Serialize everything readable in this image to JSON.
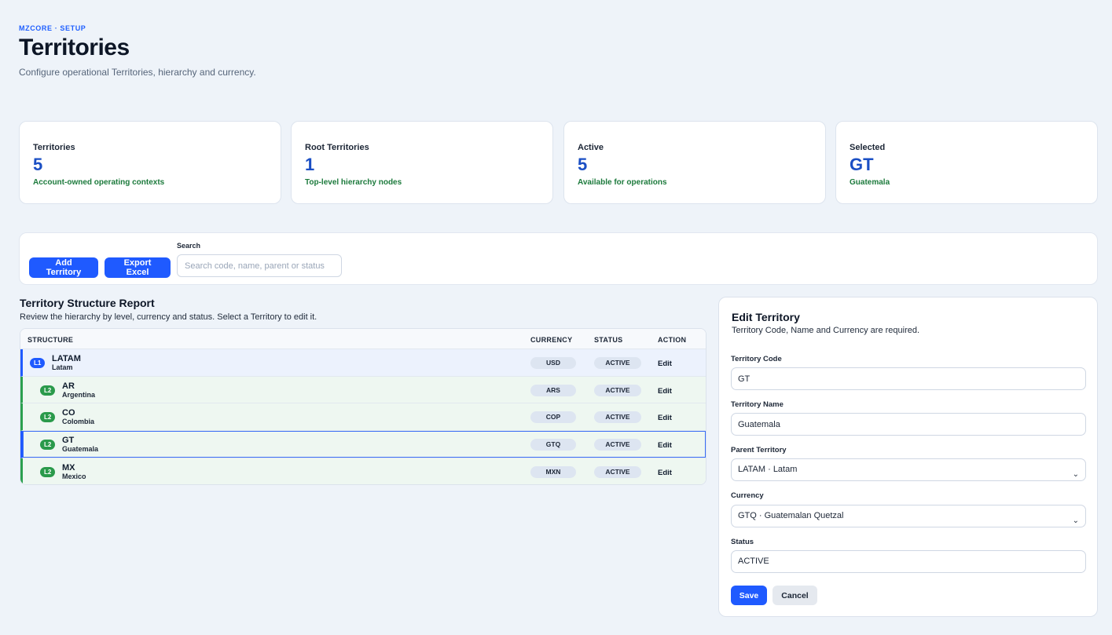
{
  "header": {
    "eyebrow": "MZCORE · SETUP",
    "title": "Territories",
    "subtitle": "Configure operational Territories, hierarchy and currency."
  },
  "stats": [
    {
      "label": "Territories",
      "value": "5",
      "note": "Account-owned operating contexts"
    },
    {
      "label": "Root Territories",
      "value": "1",
      "note": "Top-level hierarchy nodes"
    },
    {
      "label": "Active",
      "value": "5",
      "note": "Available for operations"
    },
    {
      "label": "Selected",
      "value": "GT",
      "note": "Guatemala"
    }
  ],
  "toolbar": {
    "add_label": "Add Territory",
    "export_label": "Export Excel",
    "search_label": "Search",
    "search_placeholder": "Search code, name, parent or status",
    "search_value": ""
  },
  "report": {
    "title": "Territory Structure Report",
    "subtitle": "Review the hierarchy by level, currency and status. Select a Territory to edit it.",
    "columns": {
      "structure": "STRUCTURE",
      "currency": "CURRENCY",
      "status": "STATUS",
      "action": "ACTION"
    },
    "rows": [
      {
        "level": "L1",
        "code": "LATAM",
        "name": "Latam",
        "currency": "USD",
        "status": "ACTIVE",
        "action": "Edit"
      },
      {
        "level": "L2",
        "code": "AR",
        "name": "Argentina",
        "currency": "ARS",
        "status": "ACTIVE",
        "action": "Edit"
      },
      {
        "level": "L2",
        "code": "CO",
        "name": "Colombia",
        "currency": "COP",
        "status": "ACTIVE",
        "action": "Edit"
      },
      {
        "level": "L2",
        "code": "GT",
        "name": "Guatemala",
        "currency": "GTQ",
        "status": "ACTIVE",
        "action": "Edit"
      },
      {
        "level": "L2",
        "code": "MX",
        "name": "Mexico",
        "currency": "MXN",
        "status": "ACTIVE",
        "action": "Edit"
      }
    ]
  },
  "edit": {
    "title": "Edit Territory",
    "subtitle": "Territory Code, Name and Currency are required.",
    "code_label": "Territory Code",
    "code_value": "GT",
    "name_label": "Territory Name",
    "name_value": "Guatemala",
    "parent_label": "Parent Territory",
    "parent_value": "LATAM · Latam",
    "currency_label": "Currency",
    "currency_value": "GTQ · Guatemalan Quetzal",
    "status_label": "Status",
    "status_value": "ACTIVE",
    "save_label": "Save",
    "cancel_label": "Cancel"
  },
  "colors": {
    "accent": "#1f5aff",
    "stat_value": "#1b4fc4",
    "positive": "#1c7a3c",
    "level2": "#2a9a4b"
  },
  "icons": {
    "select_chevron": "chevron-down-icon"
  }
}
